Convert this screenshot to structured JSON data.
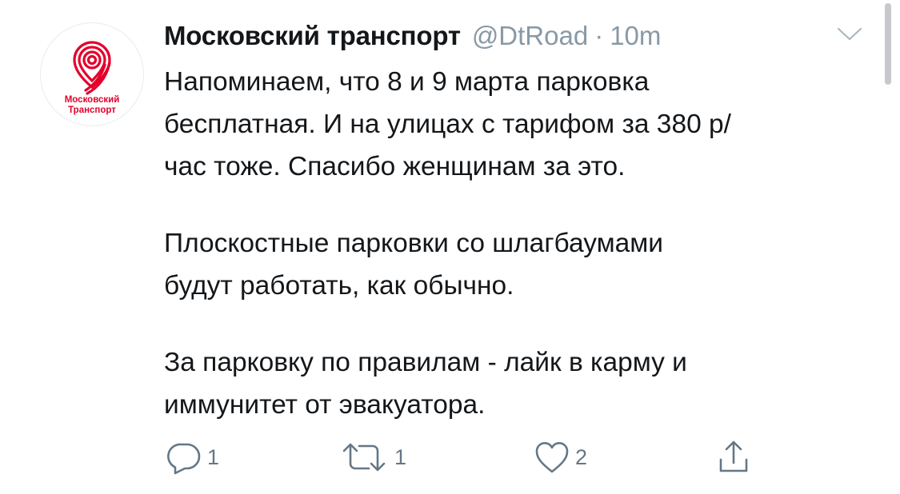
{
  "avatar": {
    "brand_line1": "Московский",
    "brand_line2": "Транспорт",
    "brand_color": "#e4002b"
  },
  "tweet": {
    "author_name": "Московский транспорт",
    "handle": "@DtRoad",
    "separator": "·",
    "time": "10m",
    "paragraphs": [
      "Напоминаем, что 8 и 9 марта парковка\nбесплатная. И на улицах с тарифом за 380 р/\nчас тоже. Спасибо женщинам за это.",
      "Плоскостные парковки со шлагбаумами\nбудут работать, как обычно.",
      "За парковку по правилам - лайк в карму и\nиммунитет от эвакуатора."
    ]
  },
  "actions": {
    "reply_count": "1",
    "retweet_count": "1",
    "like_count": "2",
    "reply_icon": "reply-icon",
    "retweet_icon": "retweet-icon",
    "like_icon": "heart-icon",
    "share_icon": "share-icon"
  },
  "colors": {
    "text": "#14171a",
    "secondary": "#8899a6",
    "icon": "#657786"
  }
}
